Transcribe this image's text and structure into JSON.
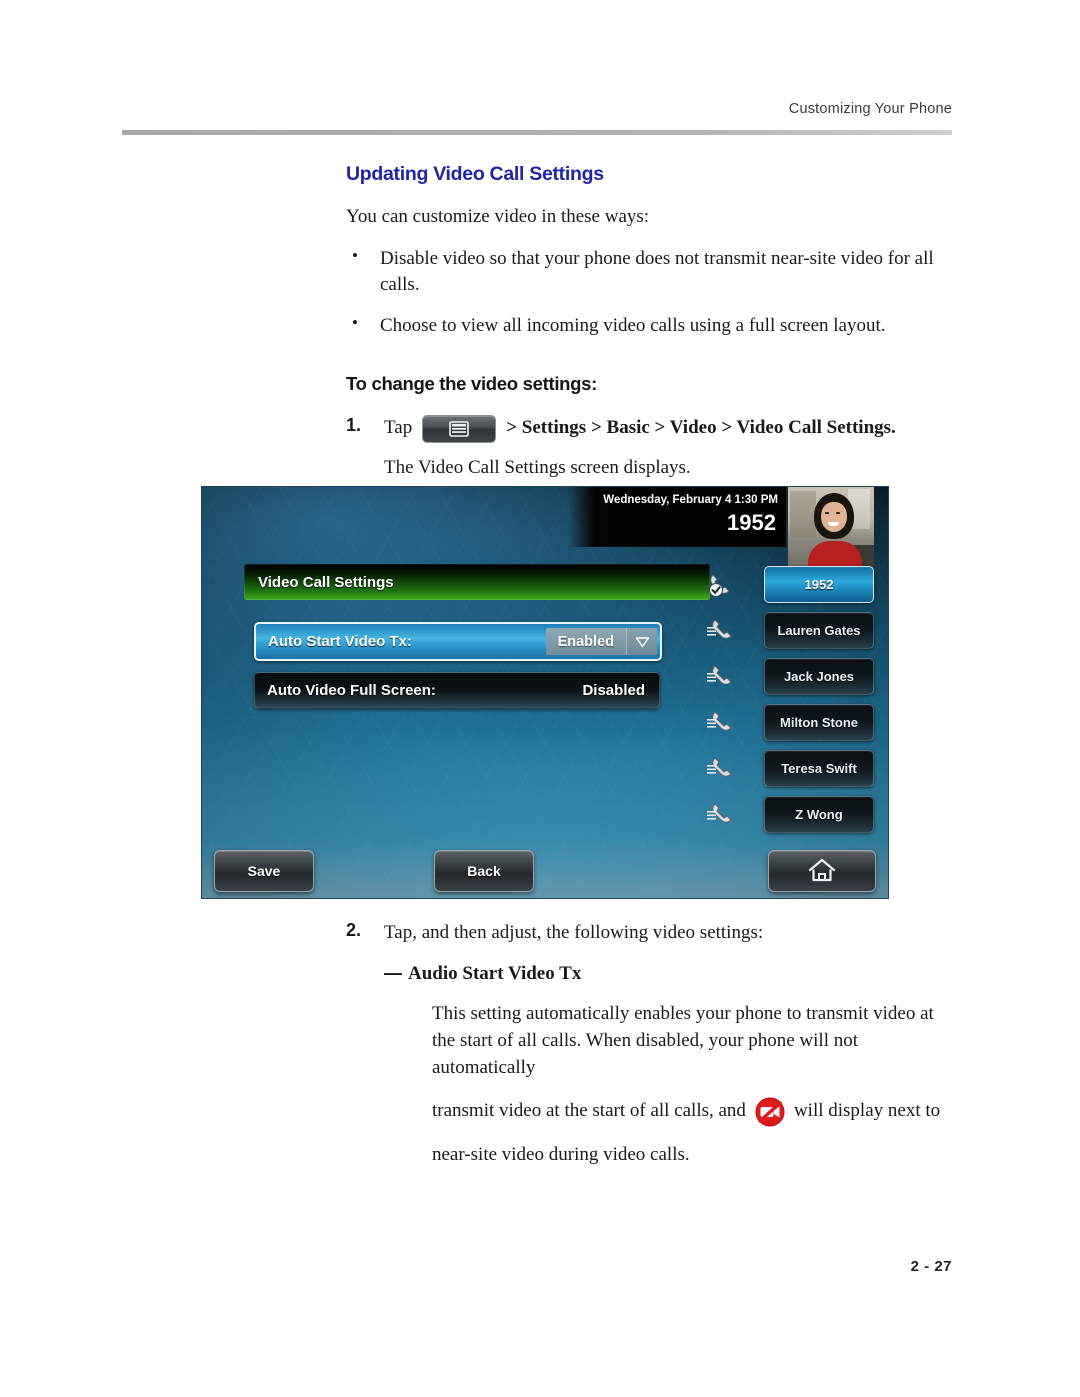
{
  "header": {
    "running_head": "Customizing Your Phone"
  },
  "footer": {
    "page_number": "2 - 27"
  },
  "section": {
    "title": "Updating Video Call Settings",
    "intro": "You can customize video in these ways:",
    "bullets": [
      "Disable video so that your phone does not transmit near-site video for all calls.",
      "Choose to view all incoming video calls using a full screen layout."
    ],
    "subsection_title": "To change the video settings:"
  },
  "steps": [
    {
      "number": "1.",
      "lead": "Tap",
      "icon": "home-menu-key-icon",
      "path": "> Settings > Basic > Video > Video Call Settings.",
      "result": "The Video Call Settings screen displays."
    },
    {
      "number": "2.",
      "lead": "Tap, and then adjust, the following video settings:",
      "item_dash": "—",
      "item_title": "Audio Start Video Tx",
      "body_part1": "This setting automatically enables your phone to transmit video at the start of all calls. When disabled, your phone will not automatically",
      "body_part2": "transmit video at the start of all calls, and",
      "body_part3": "will display next to",
      "body_part4": "near-site video during video calls."
    }
  ],
  "phone_screen": {
    "status_bar": {
      "datetime": "Wednesday, February 4  1:30 PM",
      "extension": "1952"
    },
    "title_bar": {
      "label": "Video Call Settings"
    },
    "settings": [
      {
        "label": "Auto Start Video Tx:",
        "value": "Enabled",
        "type": "dropdown",
        "selected": true
      },
      {
        "label": "Auto Video Full Screen:",
        "value": "Disabled",
        "type": "static",
        "selected": false
      }
    ],
    "contacts": [
      {
        "label": "1952",
        "active": true
      },
      {
        "label": "Lauren Gates",
        "active": false
      },
      {
        "label": "Jack Jones",
        "active": false
      },
      {
        "label": "Milton Stone",
        "active": false
      },
      {
        "label": "Teresa Swift",
        "active": false
      },
      {
        "label": "Z Wong",
        "active": false
      }
    ],
    "softkeys": {
      "save": "Save",
      "back": "Back",
      "home_icon": "home-icon"
    }
  },
  "colors": {
    "heading_blue": "#2222a8",
    "screen_green": "#3faa1c",
    "screen_blue": "#2ea9dc",
    "video_off_red": "#e01b1b"
  }
}
